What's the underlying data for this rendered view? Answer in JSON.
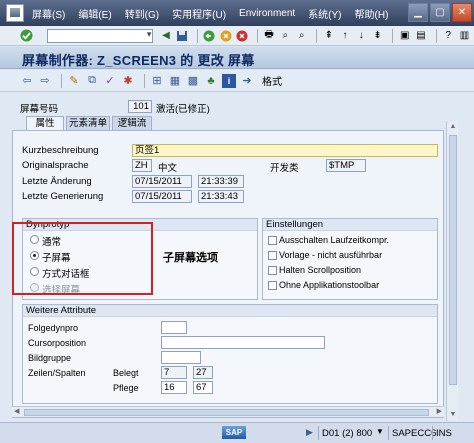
{
  "menubar": {
    "items": [
      "屏幕(S)",
      "编辑(E)",
      "转到(G)",
      "实用程序(U)",
      "Environment",
      "系统(Y)",
      "帮助(H)"
    ]
  },
  "toolbar": {
    "command_value": ""
  },
  "title": "屏幕制作器: Z_SCREEN3 的 更改 屏幕",
  "toolbar2": {
    "format_label": "格式"
  },
  "header": {
    "screen_number_label": "屏幕号码",
    "screen_number_value": "101",
    "status": "激活(已修正)"
  },
  "tabs": [
    "属性",
    "元素清单",
    "逻辑流"
  ],
  "attributes": {
    "kurz_label": "Kurzbeschreibung",
    "kurz_value": "页签1",
    "orig_label": "Originalsprache",
    "orig_code": "ZH",
    "orig_lang": "中文",
    "dev_class_label": "开发类",
    "dev_class_value": "$TMP",
    "last_change_label": "Letzte Änderung",
    "last_change_date": "07/15/2011",
    "last_change_time": "21:33:39",
    "last_gen_label": "Letzte Generierung",
    "last_gen_date": "07/15/2011",
    "last_gen_time": "21:33:43"
  },
  "dynprotyp": {
    "title": "Dynprotyp",
    "options": [
      "通常",
      "子屏幕",
      "方式对话框",
      "选择屏幕"
    ],
    "selected_index": 1
  },
  "annotation": "子屏幕选项",
  "einstellungen": {
    "title": "Einstellungen",
    "options": [
      "Ausschalten Laufzeitkompr.",
      "Vorlage - nicht ausführbar",
      "Halten Scrollposition",
      "Ohne Applikationstoolbar"
    ]
  },
  "weitere": {
    "title": "Weitere Attribute",
    "folgedynpro_label": "Folgedynpro",
    "cursor_label": "Cursorposition",
    "bildgruppe_label": "Bildgruppe",
    "zeilen_label": "Zeilen/Spalten",
    "belegt_label": "Belegt",
    "belegt_rows": "7",
    "belegt_cols": "27",
    "pflege_label": "Pflege",
    "pflege_rows": "16",
    "pflege_cols": "67"
  },
  "status": {
    "sap": "SAP",
    "session": "D01 (2) 800",
    "server": "SAPECC6",
    "mode": "INS"
  },
  "colors": {
    "menubar": "#3f5070",
    "title_text": "#0d2a63",
    "highlight": "#d42020",
    "yellow_field": "#fff6c8"
  }
}
